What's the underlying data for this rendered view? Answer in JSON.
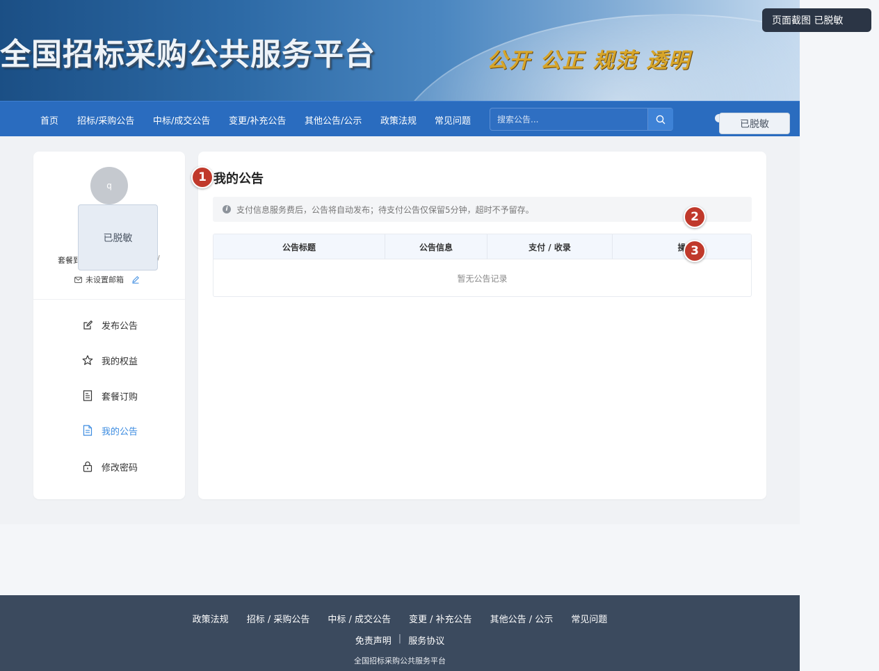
{
  "banner": {
    "title": "全国招标采购公共服务平台",
    "slogan": "公开 公正 规范 透明"
  },
  "toast": {
    "text": "页面截图  已脱敏"
  },
  "nav": {
    "items": [
      "首页",
      "招标/采购公告",
      "中标/成交公告",
      "变更/补充公告",
      "其他公告/公示",
      "政策法规",
      "常见问题"
    ],
    "search_placeholder": "搜索公告...",
    "user_button": "已脱敏"
  },
  "sidebar": {
    "avatar_letter": "q",
    "redacted_label": "已脱敏",
    "plan_prefix": "套餐到",
    "plan_suffix": "/",
    "email_status": "未设置邮箱",
    "menu": [
      {
        "label": "发布公告",
        "icon": "edit-icon"
      },
      {
        "label": "我的权益",
        "icon": "star-icon"
      },
      {
        "label": "套餐订购",
        "icon": "document-list-icon"
      },
      {
        "label": "我的公告",
        "icon": "file-text-icon",
        "active": true
      },
      {
        "label": "修改密码",
        "icon": "lock-icon"
      }
    ]
  },
  "main": {
    "title": "我的公告",
    "notice": "支付信息服务费后，公告将自动发布；待支付公告仅保留5分钟，超时不予留存。",
    "table": {
      "headers": [
        "公告标题",
        "公告信息",
        "支付 / 收录",
        "操"
      ],
      "empty_text": "暂无公告记录"
    }
  },
  "markers": [
    "1",
    "2",
    "3"
  ],
  "footer": {
    "links": [
      "政策法规",
      "招标 / 采购公告",
      "中标 / 成交公告",
      "变更 / 补充公告",
      "其他公告 / 公示",
      "常见问题"
    ],
    "legal": [
      "免责声明",
      "服务协议"
    ],
    "separator": "|",
    "copyright": "全国招标采购公共服务平台"
  },
  "colors": {
    "nav_bg": "#2a6cbf",
    "accent": "#3b8be0",
    "footer_bg": "#3b4a5e",
    "marker": "#c0392b"
  }
}
